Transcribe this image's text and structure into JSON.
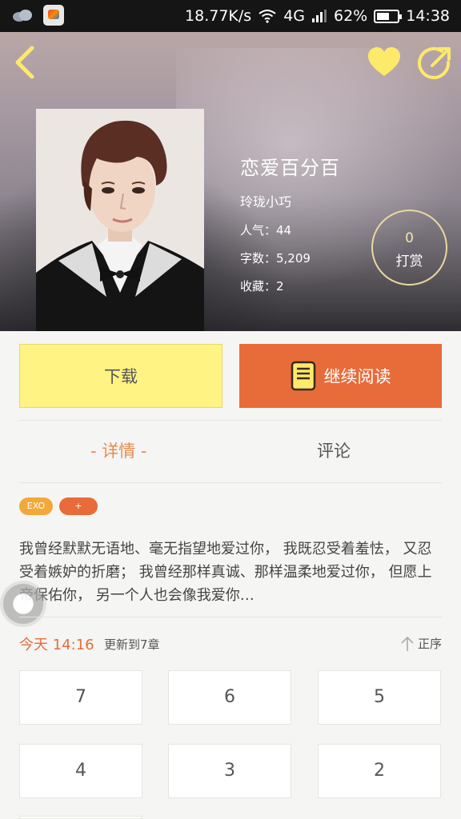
{
  "status_bar": {
    "network_speed": "18.77K/s",
    "network_type": "4G",
    "battery": "62%",
    "battery_level": 0.62,
    "time": "14:38"
  },
  "book": {
    "title": "恋爱百分百",
    "author": "玲珑小巧",
    "popularity": "人气：44",
    "word_count": "字数：5,209",
    "favorites": "收藏：2",
    "tip_count": "0",
    "tip_label": "打赏"
  },
  "actions": {
    "download_label": "下载",
    "continue_label": "继续阅读"
  },
  "tabs": {
    "details": "- 详情 -",
    "comments": "评论"
  },
  "tags": [
    {
      "label": "EXO"
    },
    {
      "label": "+"
    }
  ],
  "synopsis": " 我曾经默默无语地、毫无指望地爱过你， 我既忍受着羞怯， 又忍受着嫉妒的折磨； 我曾经那样真诚、那样温柔地爱过你， 但愿上帝保佑你， 另一个人也会像我爱你…",
  "update": {
    "time": "今天 14:16",
    "text": "更新到7章",
    "sort_label": "正序"
  },
  "chapters": [
    "7",
    "6",
    "5",
    "4",
    "3",
    "2"
  ],
  "colors": {
    "accent_orange": "#e86b3a",
    "download_yellow": "#fef383",
    "tab_active": "#e98a4c",
    "icon_yellow": "#fde96a"
  }
}
